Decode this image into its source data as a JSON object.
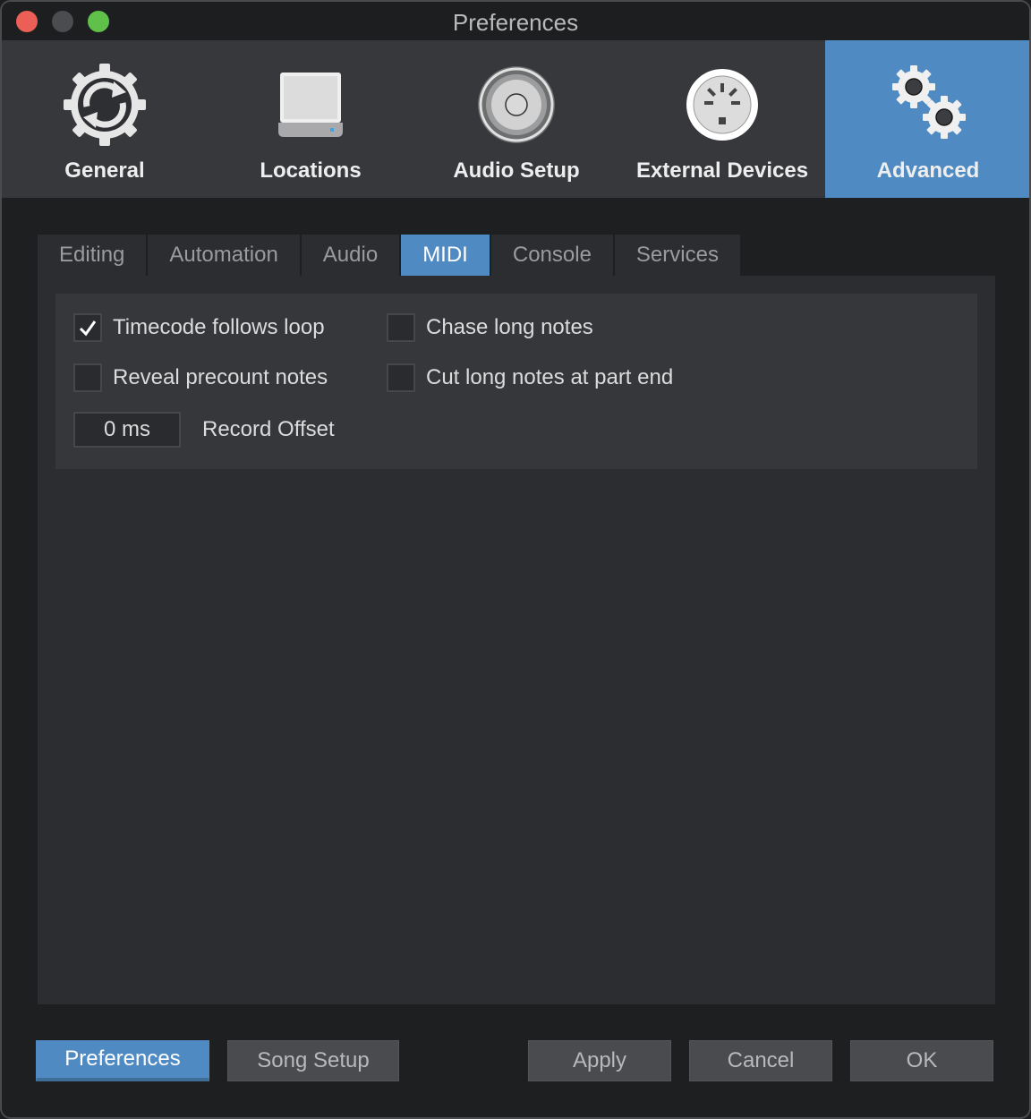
{
  "window": {
    "title": "Preferences",
    "controls": [
      "close",
      "minimize",
      "maximize"
    ]
  },
  "toolbar": {
    "items": [
      {
        "label": "General",
        "icon": "gear-sync-icon",
        "active": false
      },
      {
        "label": "Locations",
        "icon": "drive-icon",
        "active": false
      },
      {
        "label": "Audio Setup",
        "icon": "speaker-icon",
        "active": false
      },
      {
        "label": "External Devices",
        "icon": "midi-port-icon",
        "active": false
      },
      {
        "label": "Advanced",
        "icon": "gears-icon",
        "active": true
      }
    ]
  },
  "tabs": [
    {
      "label": "Editing",
      "active": false
    },
    {
      "label": "Automation",
      "active": false
    },
    {
      "label": "Audio",
      "active": false
    },
    {
      "label": "MIDI",
      "active": true
    },
    {
      "label": "Console",
      "active": false
    },
    {
      "label": "Services",
      "active": false
    }
  ],
  "midi": {
    "timecode_follows_loop": {
      "label": "Timecode follows loop",
      "checked": true
    },
    "reveal_precount_notes": {
      "label": "Reveal precount notes",
      "checked": false
    },
    "chase_long_notes": {
      "label": "Chase long notes",
      "checked": false
    },
    "cut_long_notes": {
      "label": "Cut long notes at part end",
      "checked": false
    },
    "record_offset": {
      "label": "Record Offset",
      "value": "0 ms"
    }
  },
  "footer": {
    "preferences": "Preferences",
    "song_setup": "Song Setup",
    "apply": "Apply",
    "cancel": "Cancel",
    "ok": "OK"
  },
  "colors": {
    "accent": "#4f8bc2",
    "close": "#ec5f57",
    "maximize": "#5fc04a"
  }
}
